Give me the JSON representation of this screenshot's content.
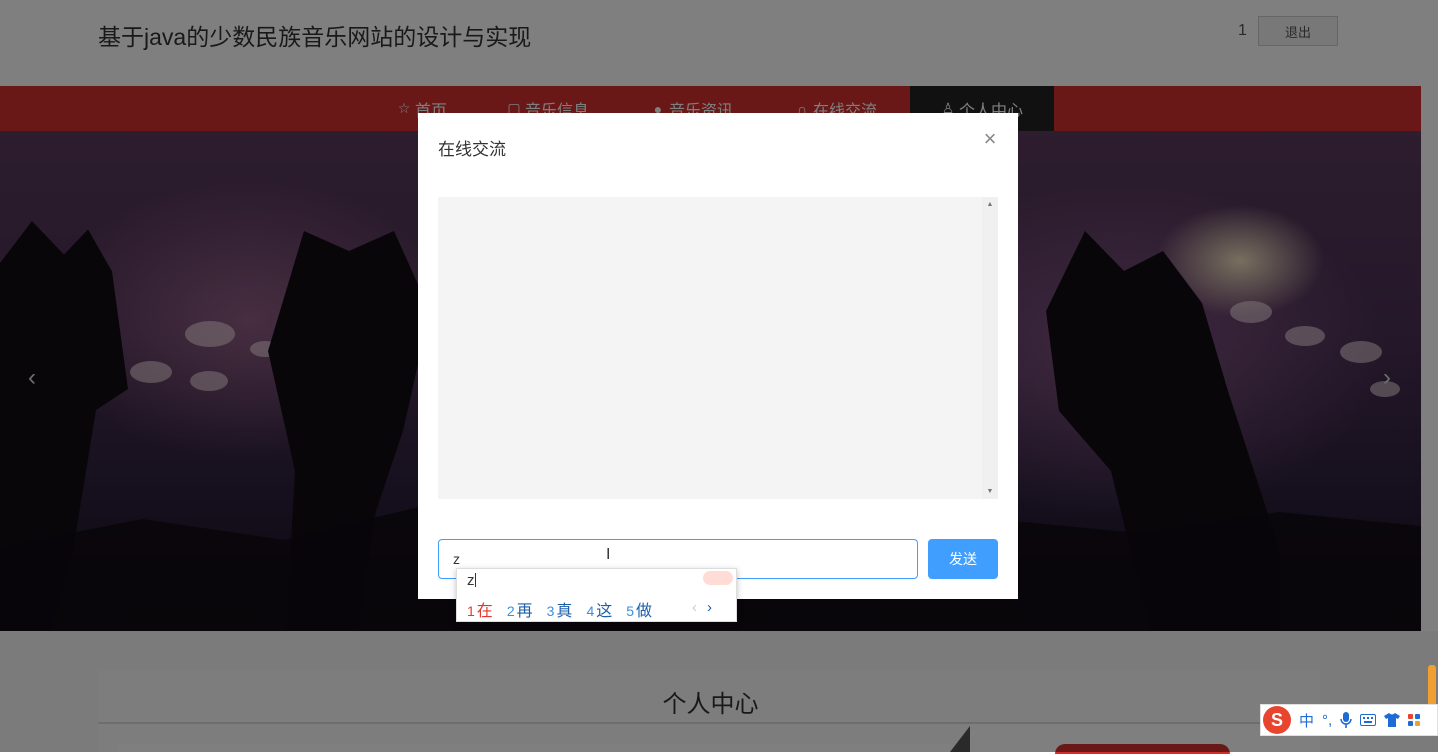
{
  "header": {
    "site_title": "基于java的少数民族音乐网站的设计与实现",
    "user_name": "1",
    "logout_label": "退出"
  },
  "nav": {
    "items": [
      {
        "label": "首页",
        "icon": "star-icon"
      },
      {
        "label": "音乐信息",
        "icon": "bag-icon"
      },
      {
        "label": "音乐资讯",
        "icon": "info-icon"
      },
      {
        "label": "在线交流",
        "icon": "headphones-icon"
      },
      {
        "label": "个人中心",
        "icon": "user-icon",
        "active": true
      }
    ]
  },
  "banner": {
    "prev_arrow": "‹",
    "next_arrow": "›"
  },
  "section": {
    "title": "个人中心"
  },
  "modal": {
    "title": "在线交流",
    "close_symbol": "×",
    "input_value": "z",
    "send_label": "发送"
  },
  "ime": {
    "composition": "z",
    "candidates": [
      {
        "num": "1",
        "char": "在"
      },
      {
        "num": "2",
        "char": "再"
      },
      {
        "num": "3",
        "char": "真"
      },
      {
        "num": "4",
        "char": "这"
      },
      {
        "num": "5",
        "char": "做"
      }
    ],
    "prev_page": "‹",
    "next_page": "›"
  },
  "ime_toolbar": {
    "logo": "S",
    "mode": "中",
    "punct": "°,"
  },
  "colors": {
    "nav_red": "#d32f2f",
    "accent_blue": "#409eff",
    "nav_active": "#222222"
  }
}
